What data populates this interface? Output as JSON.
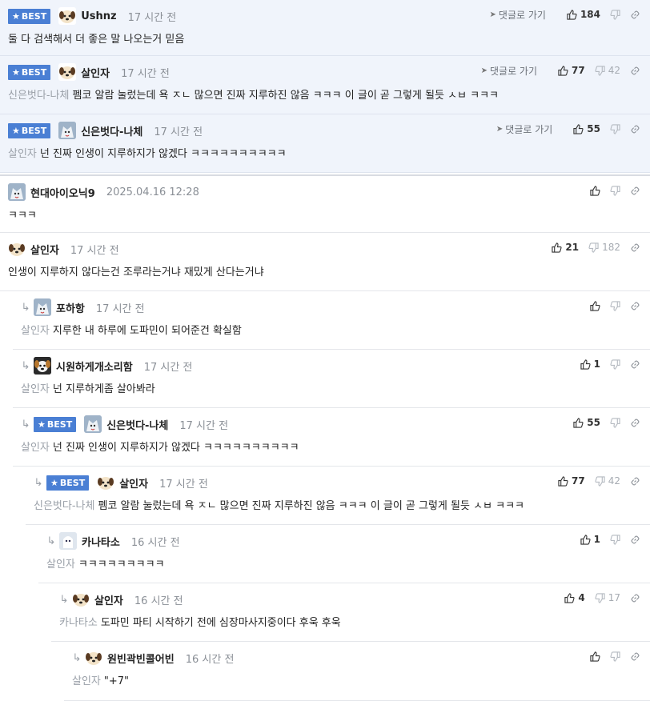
{
  "ui": {
    "best_label": "BEST",
    "goto_label": "댓글로 가기"
  },
  "comments": [
    {
      "best": true,
      "author": "Ushnz",
      "avatar": "puppy-avatar",
      "time": "17 시간 전",
      "ref": "",
      "text": "둘 다 검색해서 더 좋은 말 나오는거 믿음",
      "likes": "184",
      "dislikes": "",
      "goto": true
    },
    {
      "best": true,
      "author": "살인자",
      "avatar": "puppy-avatar",
      "time": "17 시간 전",
      "ref": "신은벗다-나체",
      "text": "펨코 알람 눌렀는데 욕 ㅈㄴ 많으면 진짜 지루하진 않음 ㅋㅋㅋ 이 글이 곧 그렇게 될듯 ㅅㅂ ㅋㅋㅋ",
      "likes": "77",
      "dislikes": "42",
      "goto": true
    },
    {
      "best": true,
      "author": "신은벗다-나체",
      "avatar": "wolf-avatar",
      "time": "17 시간 전",
      "ref": "살인자",
      "text": "넌 진짜 인생이 지루하지가 않겠다 ㅋㅋㅋㅋㅋㅋㅋㅋㅋㅋ",
      "likes": "55",
      "dislikes": "",
      "goto": true
    },
    {
      "best": false,
      "author": "현대아이오닉9",
      "avatar": "wolf-avatar",
      "time": "2025.04.16 12:28",
      "ref": "",
      "text": "ㅋㅋㅋ",
      "likes": "",
      "dislikes": "",
      "goto": false
    },
    {
      "best": false,
      "author": "살인자",
      "avatar": "puppy-avatar",
      "time": "17 시간 전",
      "ref": "",
      "text": "인생이 지루하지 않다는건 조루라는거냐 재밌게 산다는거냐",
      "likes": "21",
      "dislikes": "182",
      "goto": false
    },
    {
      "best": false,
      "author": "포하항",
      "avatar": "wolf-avatar",
      "time": "17 시간 전",
      "ref": "살인자",
      "text": "지루한 내 하루에 도파민이 되어준건 확실함",
      "likes": "",
      "dislikes": "",
      "goto": false
    },
    {
      "best": false,
      "author": "시원하게개소리함",
      "avatar": "dog-avatar",
      "time": "17 시간 전",
      "ref": "살인자",
      "text": "넌 지루하게좀 살아봐라",
      "likes": "1",
      "dislikes": "",
      "goto": false
    },
    {
      "best": true,
      "author": "신은벗다-나체",
      "avatar": "wolf-avatar",
      "time": "17 시간 전",
      "ref": "살인자",
      "text": "넌 진짜 인생이 지루하지가 않겠다 ㅋㅋㅋㅋㅋㅋㅋㅋㅋㅋ",
      "likes": "55",
      "dislikes": "",
      "goto": false
    },
    {
      "best": true,
      "author": "살인자",
      "avatar": "puppy-avatar",
      "time": "17 시간 전",
      "ref": "신은벗다-나체",
      "text": "펨코 알람 눌렀는데 욕 ㅈㄴ 많으면 진짜 지루하진 않음 ㅋㅋㅋ 이 글이 곧 그렇게 될듯 ㅅㅂ ㅋㅋㅋ",
      "likes": "77",
      "dislikes": "42",
      "goto": false
    },
    {
      "best": false,
      "author": "카나타소",
      "avatar": "ghost-avatar",
      "time": "16 시간 전",
      "ref": "살인자",
      "text": "ㅋㅋㅋㅋㅋㅋㅋㅋㅋ",
      "likes": "1",
      "dislikes": "",
      "goto": false
    },
    {
      "best": false,
      "author": "살인자",
      "avatar": "puppy-avatar",
      "time": "16 시간 전",
      "ref": "카나타소",
      "text": "도파민 파티 시작하기 전에 심장마사지중이다 후욱 후욱",
      "likes": "4",
      "dislikes": "17",
      "goto": false
    },
    {
      "best": false,
      "author": "원빈곽빈콜어빈",
      "avatar": "puppy-avatar",
      "time": "16 시간 전",
      "ref": "살인자",
      "text": "\"+7\"",
      "likes": "",
      "dislikes": "",
      "goto": false
    }
  ]
}
